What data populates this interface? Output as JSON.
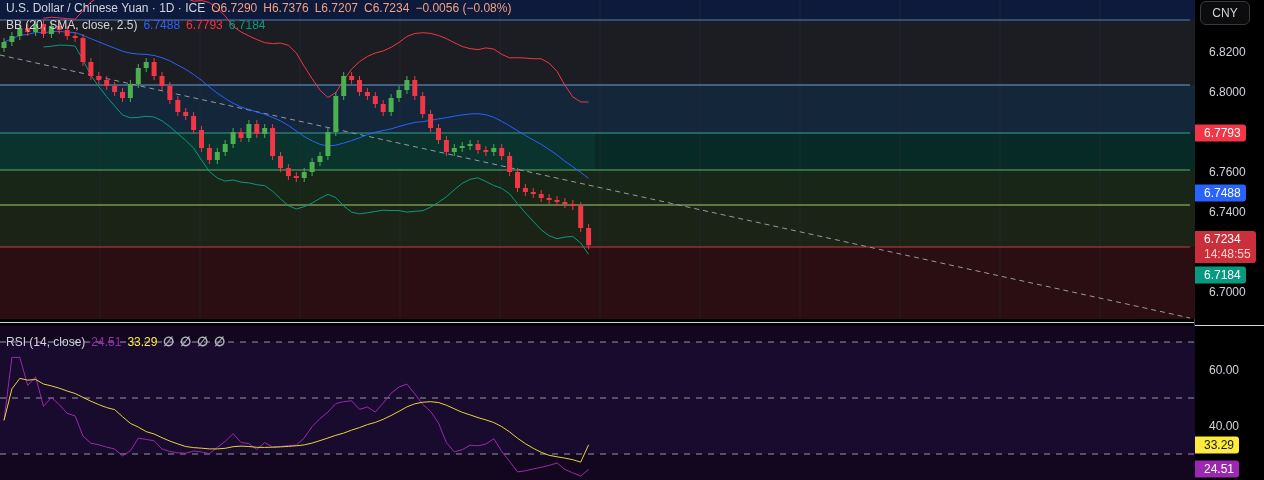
{
  "header": {
    "title": "U.S. Dollar / Chinese Yuan · 1D · ICE",
    "ohlc": [
      "O6.7290",
      "H6.7376",
      "L6.7207",
      "C6.7234"
    ],
    "change": "−0.0056 (−0.08%)"
  },
  "bb": {
    "name": "BB (20, SMA, close, 2.5)",
    "values": [
      {
        "text": "6.7488",
        "color": "#2962ff"
      },
      {
        "text": "6.7793",
        "color": "#f23645"
      },
      {
        "text": "6.7184",
        "color": "#089981"
      }
    ]
  },
  "rsi": {
    "name": "RSI (14, close)",
    "values": [
      {
        "text": "24.51",
        "color": "#9c27b0"
      },
      {
        "text": "33.29",
        "color": "#ffeb3b"
      },
      {
        "text": "∅",
        "color": "#b2b5be"
      },
      {
        "text": "∅",
        "color": "#b2b5be"
      },
      {
        "text": "∅",
        "color": "#b2b5be"
      },
      {
        "text": "∅",
        "color": "#b2b5be"
      }
    ]
  },
  "price_axis": {
    "currency": "CNY",
    "ticks": [
      "6.8200",
      "6.8000",
      "6.7600",
      "6.7400",
      "6.7000"
    ],
    "tags": [
      {
        "text": "6.7793",
        "color": "#f23645"
      },
      {
        "text": "6.7488",
        "color": "#2962ff"
      },
      {
        "text": "6.7234",
        "sub": "14:48:55",
        "color": "#cc2f3c"
      },
      {
        "text": "6.7184",
        "color": "#089981"
      }
    ]
  },
  "rsi_axis": {
    "ticks": [
      "60.00",
      "40.00"
    ],
    "tags": [
      {
        "text": "33.29",
        "color": "#ffeb3b"
      },
      {
        "text": "24.51",
        "color": "#9c27b0"
      }
    ]
  }
}
